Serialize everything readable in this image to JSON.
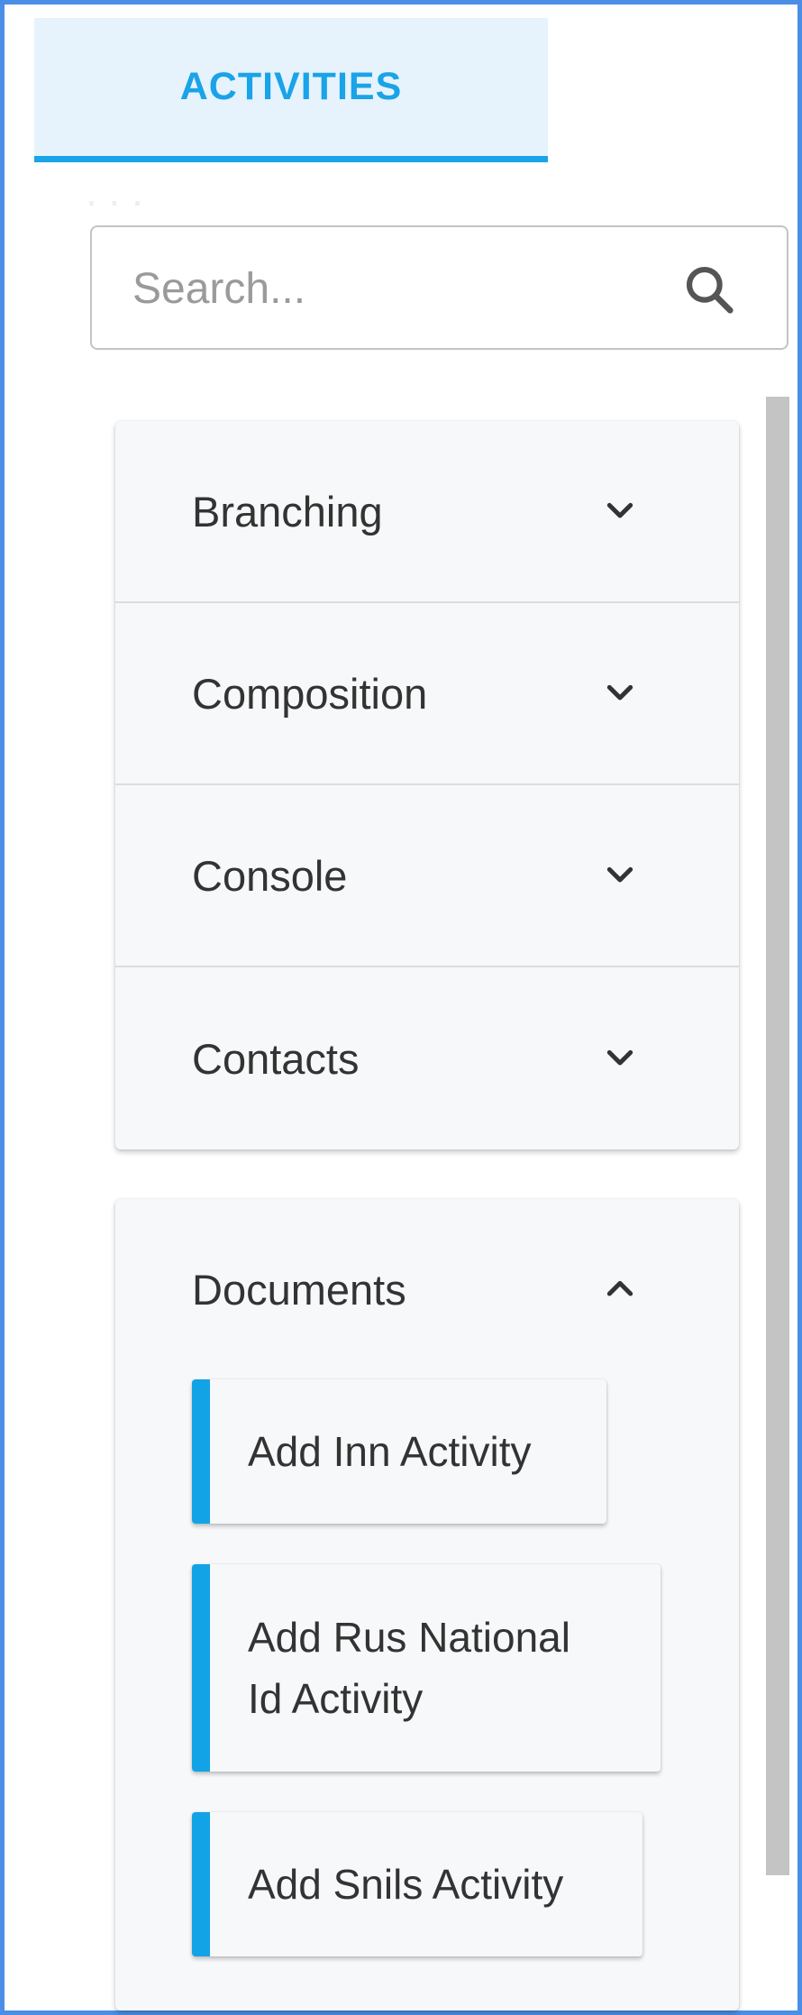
{
  "tabs": [
    {
      "label": "ACTIVITIES",
      "active": true
    }
  ],
  "search": {
    "placeholder": "Search...",
    "value": ""
  },
  "categories": [
    {
      "label": "Branching",
      "expanded": false,
      "icon": "chevron-down-icon"
    },
    {
      "label": "Composition",
      "expanded": false,
      "icon": "chevron-down-icon"
    },
    {
      "label": "Console",
      "expanded": false,
      "icon": "chevron-down-icon"
    },
    {
      "label": "Contacts",
      "expanded": false,
      "icon": "chevron-down-icon"
    }
  ],
  "documents": {
    "label": "Documents",
    "expanded": true,
    "icon": "chevron-up-icon",
    "activities": [
      {
        "line1": "Add Inn Activity",
        "line2": ""
      },
      {
        "line1": "Add Rus National",
        "line2": "Id Activity"
      },
      {
        "line1": "Add Snils Activity",
        "line2": ""
      }
    ]
  },
  "colors": {
    "accent": "#1aa3e8",
    "tab_bg": "#e6f3fc",
    "frame_border": "#4a8ee6",
    "card_bg": "#f7f8fa",
    "scrollbar": "#c4c4c4"
  }
}
